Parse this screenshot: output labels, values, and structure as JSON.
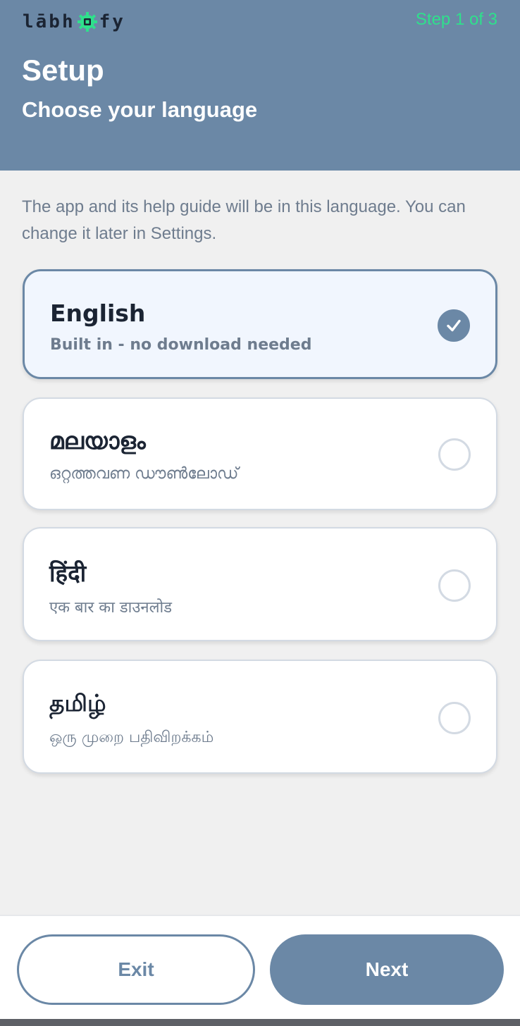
{
  "header": {
    "brand_prefix": "lābh",
    "brand_suffix": "fy",
    "brand_icon": "gear-chip-icon",
    "step": "Step 1 of 3",
    "title": "Setup",
    "subtitle": "Choose your language"
  },
  "description": "The app and its help guide will be in this language. You can change it later in Settings.",
  "languages": [
    {
      "name": "English",
      "note": "Built in - no download needed",
      "selected": true
    },
    {
      "name": "മലയാളം",
      "note": "ഒറ്റത്തവണ ഡൗൺലോഡ്",
      "selected": false
    },
    {
      "name": "हिंदी",
      "note": "एक बार का डाउनलोड",
      "selected": false
    },
    {
      "name": "தமிழ்",
      "note": "ஒரு முறை பதிவிறக்கம்",
      "selected": false
    }
  ],
  "footer": {
    "exit_label": "Exit",
    "next_label": "Next"
  },
  "colors": {
    "header_bg": "#6b88a6",
    "step_accent": "#2fe08c",
    "brand_gear": "#2fe08c",
    "selected_border": "#6b88a6",
    "selected_bg": "#f1f6fe"
  }
}
